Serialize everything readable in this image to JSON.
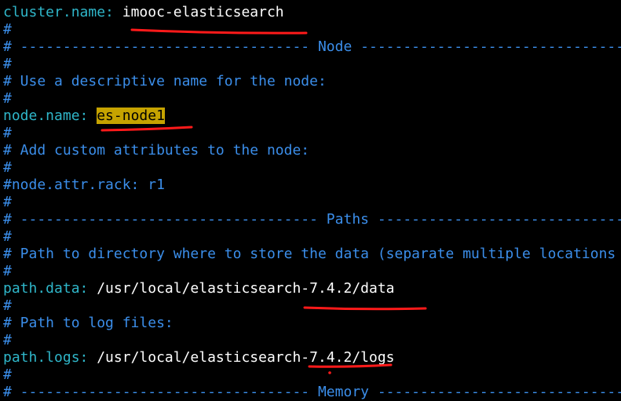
{
  "colors": {
    "background": "#000000",
    "comment": "#3b8eea",
    "key": "#2fb6c9",
    "value": "#ffffff",
    "search_highlight": "#c6a300",
    "annotation": "#ff1a1a"
  },
  "lines": {
    "l1_key": "cluster.name:",
    "l1_value": "imooc-elasticsearch",
    "l2": "#",
    "l3": "# ---------------------------------- Node ------------------------------------",
    "l4": "#",
    "l5": "# Use a descriptive name for the node:",
    "l6": "#",
    "l7_key": "node.name:",
    "l7_value": "es-node1",
    "l8": "#",
    "l9": "# Add custom attributes to the node:",
    "l10": "#",
    "l11": "#node.attr.rack: r1",
    "l12": "#",
    "l13": "# ----------------------------------- Paths ------------------------------------",
    "l14": "#",
    "l15": "# Path to directory where to store the data (separate multiple locations",
    "l16": "#",
    "l17_key": "path.data:",
    "l17_value": "/usr/local/elasticsearch-7.4.2/data",
    "l18": "#",
    "l19": "# Path to log files:",
    "l20": "#",
    "l21_key": "path.logs:",
    "l21_value": "/usr/local/elasticsearch-7.4.2/logs",
    "l22": "#",
    "l23": "# ---------------------------------- Memory ----------------------------------"
  }
}
